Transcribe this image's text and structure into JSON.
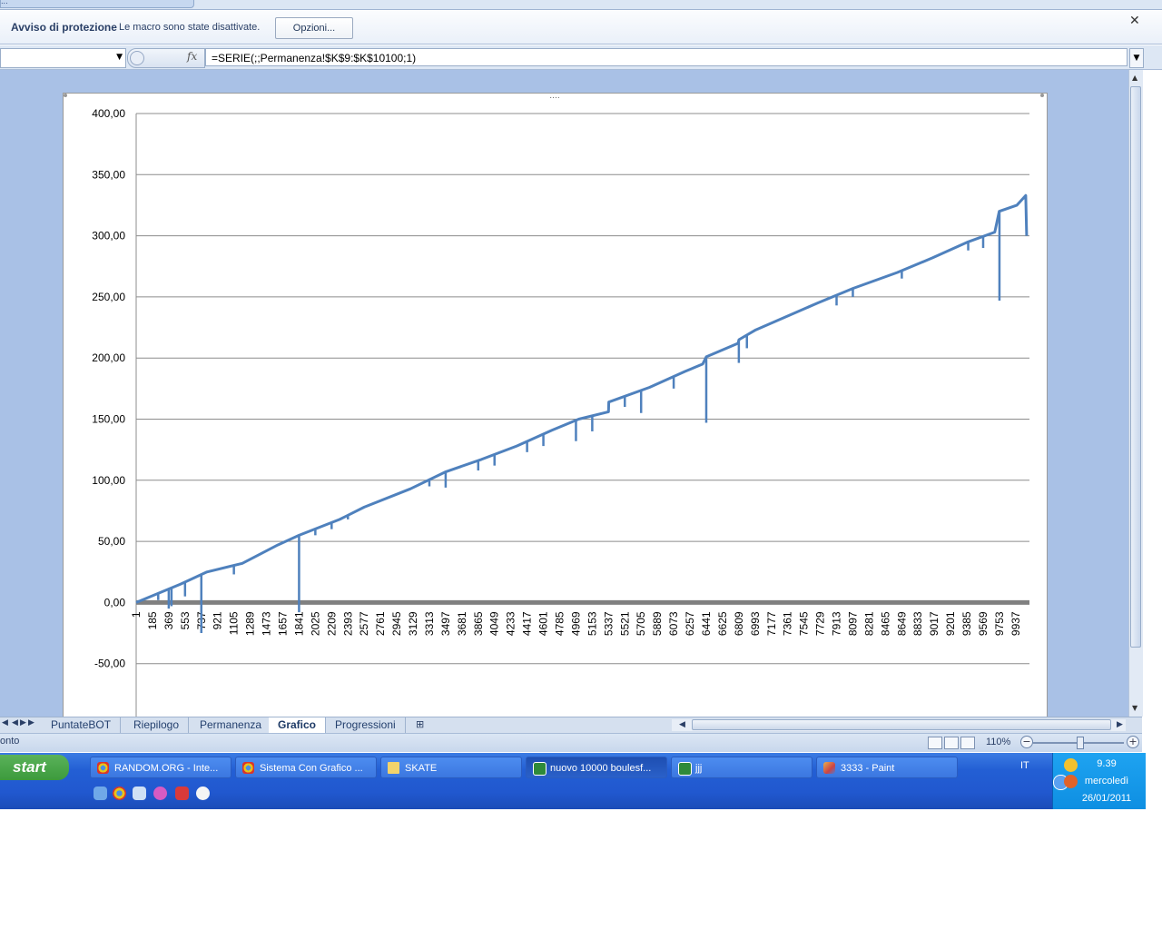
{
  "topbar": {
    "text": "..."
  },
  "security_bar": {
    "title": "Avviso di protezione",
    "message": "Le macro sono state disattivate.",
    "options_label": "Opzioni...",
    "close_glyph": "✕"
  },
  "formula_bar": {
    "fx_label": "fx",
    "formula": "=SERIE(;;Permanenza!$K$9:$K$10100;1)"
  },
  "sheet_tabs": [
    {
      "label": "PuntateBOT",
      "active": false
    },
    {
      "label": "Riepilogo",
      "active": false
    },
    {
      "label": "Permanenza",
      "active": false
    },
    {
      "label": "Grafico",
      "active": true
    },
    {
      "label": "Progressioni",
      "active": false
    }
  ],
  "status_bar": {
    "left_text": "onto",
    "zoom": "110%"
  },
  "taskbar": {
    "start_label": "start",
    "windows": [
      {
        "label": "RANDOM.ORG - Inte...",
        "icon": "chrome-icon",
        "active": false
      },
      {
        "label": "Sistema Con Grafico ...",
        "icon": "chrome-icon",
        "active": false
      },
      {
        "label": "SKATE",
        "icon": "folder-icon",
        "active": false
      },
      {
        "label": "nuovo 10000 boulesf...",
        "icon": "excel-icon",
        "active": true
      },
      {
        "label": "jjj",
        "icon": "excel-icon",
        "active": false
      },
      {
        "label": "3333 - Paint",
        "icon": "paint-icon",
        "active": false
      }
    ],
    "language": "IT",
    "clock": {
      "time": "9.39",
      "day": "mercoledì",
      "date": "26/01/2011"
    }
  },
  "colors": {
    "series": "#4f81bd",
    "workspace": "#a9c1e6",
    "taskbar": "#2158cf"
  },
  "chart_data": {
    "type": "line",
    "ylim": [
      -50,
      400
    ],
    "yticks": [
      "400,00",
      "350,00",
      "300,00",
      "250,00",
      "200,00",
      "150,00",
      "100,00",
      "50,00",
      "0,00",
      "-50,00"
    ],
    "yvalues": [
      400,
      350,
      300,
      250,
      200,
      150,
      100,
      50,
      0,
      -50
    ],
    "xticks": [
      "1",
      "185",
      "369",
      "553",
      "737",
      "921",
      "1105",
      "1289",
      "1473",
      "1657",
      "1841",
      "2025",
      "2209",
      "2393",
      "2577",
      "2761",
      "2945",
      "3129",
      "3313",
      "3497",
      "3681",
      "3865",
      "4049",
      "4233",
      "4417",
      "4601",
      "4785",
      "4969",
      "5153",
      "5337",
      "5521",
      "5705",
      "5889",
      "6073",
      "6257",
      "6441",
      "6625",
      "6809",
      "6993",
      "7177",
      "7361",
      "7545",
      "7729",
      "7913",
      "8097",
      "8281",
      "8465",
      "8649",
      "8833",
      "9017",
      "9201",
      "9385",
      "9569",
      "9753",
      "9937"
    ],
    "xmax": 10092,
    "grid": true,
    "legend": "none",
    "series": [
      {
        "points": [
          [
            1,
            0
          ],
          [
            500,
            15
          ],
          [
            800,
            25
          ],
          [
            1200,
            32
          ],
          [
            1600,
            47
          ],
          [
            1841,
            55
          ],
          [
            2300,
            68
          ],
          [
            2577,
            78
          ],
          [
            3100,
            93
          ],
          [
            3500,
            107
          ],
          [
            3900,
            117
          ],
          [
            4300,
            128
          ],
          [
            4700,
            141
          ],
          [
            5000,
            150
          ],
          [
            5337,
            156
          ],
          [
            5340,
            164
          ],
          [
            5800,
            176
          ],
          [
            6200,
            189
          ],
          [
            6400,
            195
          ],
          [
            6441,
            201
          ],
          [
            6800,
            212
          ],
          [
            6810,
            215
          ],
          [
            7000,
            223
          ],
          [
            7700,
            245
          ],
          [
            8100,
            257
          ],
          [
            8600,
            270
          ],
          [
            9000,
            282
          ],
          [
            9400,
            295
          ],
          [
            9700,
            303
          ],
          [
            9750,
            320
          ],
          [
            9950,
            325
          ],
          [
            10050,
            333
          ],
          [
            10060,
            300
          ]
        ],
        "dips": [
          [
            250,
            2
          ],
          [
            369,
            -5
          ],
          [
            400,
            -3
          ],
          [
            553,
            5
          ],
          [
            737,
            -25
          ],
          [
            1105,
            23
          ],
          [
            1841,
            -8
          ],
          [
            2025,
            55
          ],
          [
            2209,
            60
          ],
          [
            2393,
            68
          ],
          [
            3313,
            95
          ],
          [
            3497,
            94
          ],
          [
            3865,
            108
          ],
          [
            4049,
            112
          ],
          [
            4417,
            123
          ],
          [
            4601,
            128
          ],
          [
            4969,
            132
          ],
          [
            5153,
            140
          ],
          [
            5521,
            160
          ],
          [
            5705,
            155
          ],
          [
            6073,
            175
          ],
          [
            6441,
            147
          ],
          [
            6809,
            196
          ],
          [
            6900,
            208
          ],
          [
            7913,
            243
          ],
          [
            8097,
            250
          ],
          [
            8650,
            265
          ],
          [
            9400,
            288
          ],
          [
            9569,
            290
          ],
          [
            9753,
            247
          ]
        ]
      }
    ]
  }
}
